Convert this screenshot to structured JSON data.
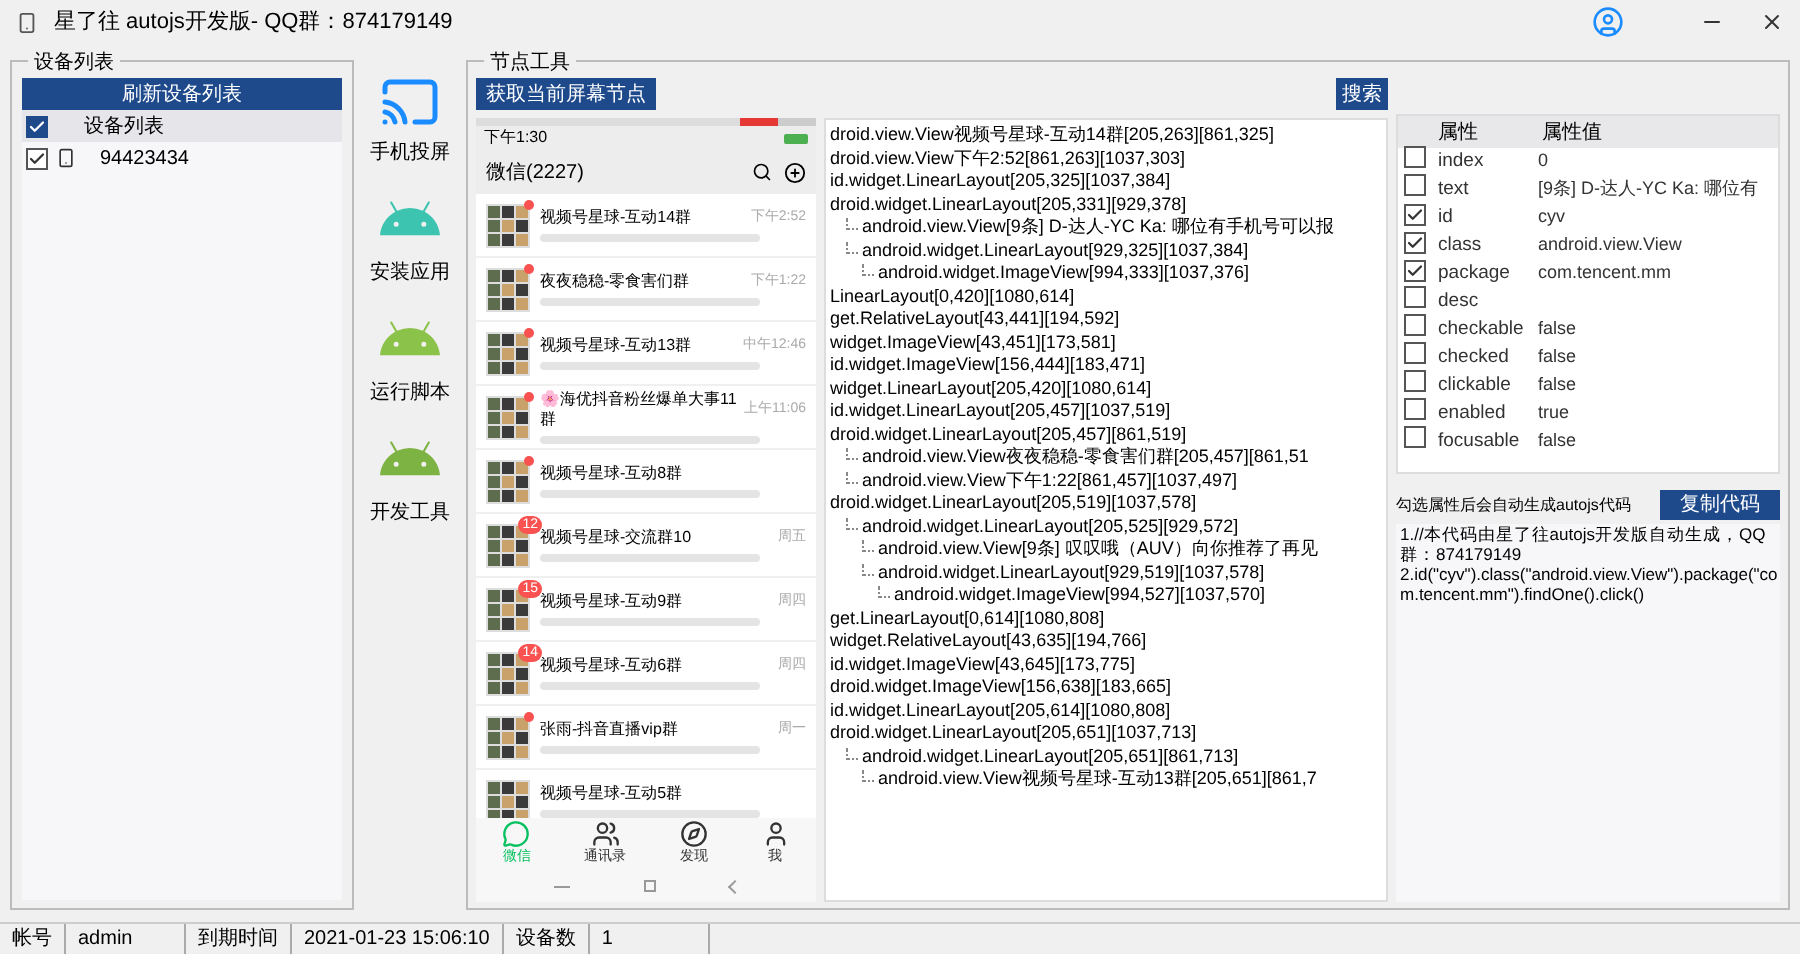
{
  "window": {
    "title": "星了往 autojs开发版- QQ群：874179149"
  },
  "device_panel": {
    "title": "设备列表",
    "refresh_button": "刷新设备列表",
    "header": {
      "label": "设备列表",
      "checked": true
    },
    "devices": [
      {
        "name": "94423434",
        "checked": true
      }
    ]
  },
  "tools": [
    {
      "label": "手机投屏",
      "kind": "screen"
    },
    {
      "label": "安装应用",
      "kind": "install"
    },
    {
      "label": "运行脚本",
      "kind": "script"
    },
    {
      "label": "开发工具",
      "kind": "dev"
    }
  ],
  "node_panel": {
    "title": "节点工具",
    "capture_button": "获取当前屏幕节点",
    "search_button": "搜索"
  },
  "phone": {
    "time": "下午1:30",
    "app_title": "微信(2227)",
    "chats": [
      {
        "title": "视频号星球-互动14群",
        "time": "下午2:52",
        "dot": true
      },
      {
        "title": "夜夜稳稳-零食害们群",
        "time": "下午1:22",
        "dot": true
      },
      {
        "title": "视频号星球-互动13群",
        "time": "中午12:46",
        "dot": true
      },
      {
        "title": "🌸海优抖音粉丝爆单大事11群",
        "time": "上午11:06",
        "dot": true
      },
      {
        "title": "视频号星球-互动8群",
        "dot": true
      },
      {
        "title": "视频号星球-交流群10",
        "time": "周五",
        "badge": "12",
        "dot": false
      },
      {
        "title": "视频号星球-互动9群",
        "time": "周四",
        "badge": "15",
        "dot": false
      },
      {
        "title": "视频号星球-互动6群",
        "time": "周四",
        "badge": "14",
        "dot": false
      },
      {
        "title": "张雨-抖音直播vip群",
        "time": "周一",
        "dot": true
      },
      {
        "title": "视频号星球-互动5群",
        "dot": false
      }
    ],
    "nav": [
      {
        "label": "微信",
        "selected": true,
        "kind": "chat"
      },
      {
        "label": "通讯录",
        "selected": false,
        "kind": "contacts"
      },
      {
        "label": "发现",
        "selected": false,
        "kind": "discover"
      },
      {
        "label": "我",
        "selected": false,
        "kind": "me"
      }
    ]
  },
  "tree": [
    {
      "text": "droid.view.View视频号星球-互动14群[205,263][861,325]"
    },
    {
      "text": "droid.view.View下午2:52[861,263][1037,303]"
    },
    {
      "text": "id.widget.LinearLayout[205,325][1037,384]"
    },
    {
      "text": "droid.widget.LinearLayout[205,331][929,378]",
      "children": [
        {
          "text": "android.view.View[9条] D-达人-YC  Ka: 哪位有手机号可以报"
        },
        {
          "text": "android.widget.LinearLayout[929,325][1037,384]",
          "children": [
            {
              "text": "android.widget.ImageView[994,333][1037,376]"
            }
          ]
        }
      ]
    },
    {
      "text": "LinearLayout[0,420][1080,614]"
    },
    {
      "text": "get.RelativeLayout[43,441][194,592]"
    },
    {
      "text": "widget.ImageView[43,451][173,581]"
    },
    {
      "text": "id.widget.ImageView[156,444][183,471]"
    },
    {
      "text": "widget.LinearLayout[205,420][1080,614]"
    },
    {
      "text": "id.widget.LinearLayout[205,457][1037,519]"
    },
    {
      "text": "droid.widget.LinearLayout[205,457][861,519]",
      "children": [
        {
          "text": "android.view.View夜夜稳稳-零食害们群[205,457][861,51"
        },
        {
          "text": "android.view.View下午1:22[861,457][1037,497]"
        }
      ]
    },
    {
      "text": "droid.widget.LinearLayout[205,519][1037,578]",
      "children": [
        {
          "text": "android.widget.LinearLayout[205,525][929,572]",
          "children": [
            {
              "text": "android.view.View[9条] 叹叹哦（AUV）向你推荐了再见"
            },
            {
              "text": "android.widget.LinearLayout[929,519][1037,578]",
              "children": [
                {
                  "text": "android.widget.ImageView[994,527][1037,570]"
                }
              ]
            }
          ]
        }
      ]
    },
    {
      "text": "get.LinearLayout[0,614][1080,808]"
    },
    {
      "text": "widget.RelativeLayout[43,635][194,766]"
    },
    {
      "text": "id.widget.ImageView[43,645][173,775]"
    },
    {
      "text": "droid.widget.ImageView[156,638][183,665]"
    },
    {
      "text": "id.widget.LinearLayout[205,614][1080,808]"
    },
    {
      "text": "droid.widget.LinearLayout[205,651][1037,713]",
      "children": [
        {
          "text": "android.widget.LinearLayout[205,651][861,713]",
          "children": [
            {
              "text": "android.view.View视频号星球-互动13群[205,651][861,7"
            }
          ]
        }
      ]
    }
  ],
  "properties": {
    "columns": [
      "属性",
      "属性值"
    ],
    "rows": [
      {
        "name": "index",
        "value": "0",
        "checked": false
      },
      {
        "name": "text",
        "value": "[9条] D-达人-YC  Ka: 哪位有",
        "checked": false
      },
      {
        "name": "id",
        "value": "cyv",
        "checked": true
      },
      {
        "name": "class",
        "value": "android.view.View",
        "checked": true
      },
      {
        "name": "package",
        "value": "com.tencent.mm",
        "checked": true
      },
      {
        "name": "desc",
        "value": "",
        "checked": false
      },
      {
        "name": "checkable",
        "value": "false",
        "checked": false
      },
      {
        "name": "checked",
        "value": "false",
        "checked": false
      },
      {
        "name": "clickable",
        "value": "false",
        "checked": false
      },
      {
        "name": "enabled",
        "value": "true",
        "checked": false
      },
      {
        "name": "focusable",
        "value": "false",
        "checked": false
      }
    ]
  },
  "code": {
    "hint": "勾选属性后会自动生成autojs代码",
    "copy_button": "复制代码",
    "lines": [
      "1.//本代码由星了往autojs开发版自动生成，QQ群：874179149",
      "2.id(\"cyv\").class(\"android.view.View\").package(\"com.tencent.mm\").findOne().click()"
    ]
  },
  "status_bar": [
    {
      "label": "帐号",
      "value": "admin"
    },
    {
      "label": "到期时间",
      "value": "2021-01-23 15:06:10"
    },
    {
      "label": "设备数",
      "value": "1"
    }
  ]
}
